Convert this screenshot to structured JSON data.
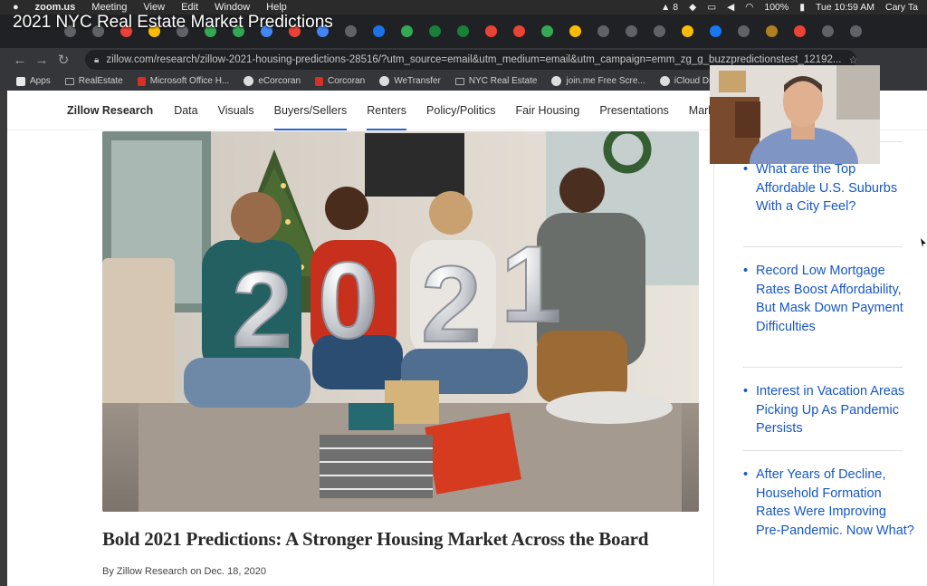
{
  "menubar": {
    "apple": "",
    "app": "zoom.us",
    "items": [
      "Meeting",
      "View",
      "Edit",
      "Window",
      "Help"
    ],
    "status": {
      "notifications": "8",
      "battery": "100%",
      "clock": "Tue 10:59 AM",
      "user": "Cary Ta"
    }
  },
  "zoom_title": "2021 NYC Real Estate Market Predictions",
  "tab_icon_colors": [
    "#5f6368",
    "#5f6368",
    "#ea4335",
    "#fbbc04",
    "#5f6368",
    "#34a853",
    "#34a853",
    "#4285f4",
    "#ea4335",
    "#4285f4",
    "#5f6368",
    "#1a73e8",
    "#34a853",
    "#188038",
    "#188038",
    "#ea4335",
    "#ea4335",
    "#34a853",
    "#fbbc04",
    "#5f6368",
    "#5f6368",
    "#5f6368",
    "#fbbc04",
    "#1877f2",
    "#5f6368",
    "#b08020",
    "#ea4335",
    "#5f6368",
    "#5f6368"
  ],
  "address": {
    "url": "zillow.com/research/zillow-2021-housing-predictions-28516/?utm_source=email&utm_medium=email&utm_campaign=emm_zg_g_buzzpredictionstest_12192..."
  },
  "ext_label": "39",
  "bookmarks": [
    {
      "label": "Apps",
      "icon": "apps-grid-icon"
    },
    {
      "label": "RealEstate",
      "icon": "folder-icon"
    },
    {
      "label": "Microsoft Office H...",
      "icon": "office-icon"
    },
    {
      "label": "eCorcoran",
      "icon": "circle-c-icon"
    },
    {
      "label": "Corcoran",
      "icon": "corcoran-icon"
    },
    {
      "label": "WeTransfer",
      "icon": "wetransfer-icon"
    },
    {
      "label": "NYC Real Estate",
      "icon": "folder-icon"
    },
    {
      "label": "join.me Free Scre...",
      "icon": "joinme-icon"
    },
    {
      "label": "iCloud Dr",
      "icon": "apple-icon"
    }
  ],
  "site_nav": {
    "brand": "Zillow Research",
    "items": [
      {
        "label": "Data",
        "underlined": false
      },
      {
        "label": "Visuals",
        "underlined": false
      },
      {
        "label": "Buyers/Sellers",
        "underlined": true
      },
      {
        "label": "Renters",
        "underlined": true
      },
      {
        "label": "Policy/Politics",
        "underlined": false
      },
      {
        "label": "Fair Housing",
        "underlined": false
      },
      {
        "label": "Presentations",
        "underlined": false
      },
      {
        "label": "Market Re",
        "underlined": false
      }
    ]
  },
  "article": {
    "balloon_digits": [
      "2",
      "0",
      "2",
      "1"
    ],
    "headline": "Bold 2021 Predictions: A Stronger Housing Market Across the Board",
    "byline": "By Zillow Research on Dec. 18, 2020"
  },
  "related": [
    "What are the Top Affordable U.S. Suburbs With a City Feel?",
    "Record Low Mortgage Rates Boost Affordability, But Mask Down Payment Difficulties",
    "Interest in Vacation Areas Picking Up As Pandemic Persists",
    "After Years of Decline, Household Formation Rates Were Improving Pre-Pandemic. Now What?"
  ]
}
